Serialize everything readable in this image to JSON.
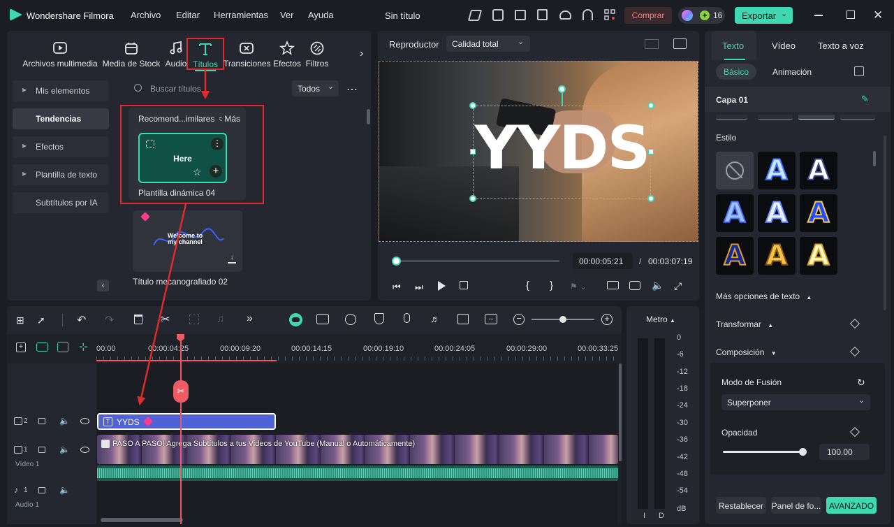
{
  "app": {
    "name": "Wondershare Filmora",
    "project_title": "Sin título",
    "menu": [
      "Archivo",
      "Editar",
      "Herramientas",
      "Ver",
      "Ayuda"
    ],
    "buy_label": "Comprar",
    "credits": "16",
    "export_label": "Exportar"
  },
  "media_tabs": [
    {
      "label": "Archivos multimedia",
      "icon": "media-icon"
    },
    {
      "label": "Media de Stock",
      "icon": "stock-icon"
    },
    {
      "label": "Audio",
      "icon": "music-note-icon"
    },
    {
      "label": "Títulos",
      "icon": "title-t-icon"
    },
    {
      "label": "Transiciones",
      "icon": "transition-icon"
    },
    {
      "label": "Efectos",
      "icon": "effects-icon"
    },
    {
      "label": "Filtros",
      "icon": "filter-icon"
    }
  ],
  "library": {
    "sidebar": [
      "Mis elementos",
      "Tendencias",
      "Efectos",
      "Plantilla de texto",
      "Subtítulos por IA"
    ],
    "search_placeholder": "Buscar títulos",
    "filter_value": "Todos",
    "recommend_header": "Recomend...imilares",
    "recommend_more": "Más >",
    "card1_preview_text": "Here",
    "card1_label": "Plantilla dinámica 04",
    "card2_preview_text": "Welcome to my channel",
    "card2_label": "Título mecanografiado 02"
  },
  "player": {
    "label": "Reproductor",
    "quality": "Calidad total",
    "overlay_text": "YYDS",
    "current_time": "00:00:05:21",
    "separator": "/",
    "total_time": "00:03:07:19",
    "progress": 0.024
  },
  "timeline": {
    "ruler": [
      "00:00",
      "00:00:04:25",
      "00:00:09:20",
      "00:00:14:15",
      "00:00:19:10",
      "00:00:24:05",
      "00:00:29:00",
      "00:00:33:25"
    ],
    "tracks": [
      {
        "num": "2",
        "name": "",
        "clip": "YYDS"
      },
      {
        "num": "1",
        "name": "Vídeo 1",
        "clip": "PASO A PASO! Agrega Subtítulos a tus Videos de YouTube (Manual o Automáticamente)"
      },
      {
        "num": "1",
        "name": "Audio 1",
        "clip": ""
      }
    ]
  },
  "meter": {
    "label": "Metro",
    "scale": [
      "0",
      "-6",
      "-12",
      "-18",
      "-24",
      "-30",
      "-36",
      "-42",
      "-48",
      "-54",
      "dB"
    ],
    "channels": [
      "I",
      "D"
    ]
  },
  "inspector": {
    "tabs": [
      "Texto",
      "Vídeo",
      "Texto a voz"
    ],
    "subtabs": [
      "Básico",
      "Animación"
    ],
    "layer": "Capa 01",
    "style_label": "Estilo",
    "more_text_options": "Más opciones de texto",
    "transform": "Transformar",
    "composition": "Composición",
    "blend_mode_label": "Modo de Fusión",
    "blend_mode_value": "Superponer",
    "opacity_label": "Opacidad",
    "opacity_value": "100.00",
    "opacity": 1.0,
    "reset_label": "Restablecer",
    "panel_label": "Panel de fo...",
    "advanced_label": "AVANZADO"
  },
  "colors": {
    "accent": "#3fd9b1",
    "highlight": "#e02b2b",
    "buy": "#f2807e",
    "playhead": "#f05a64",
    "clip_title": "#4f62d6"
  }
}
